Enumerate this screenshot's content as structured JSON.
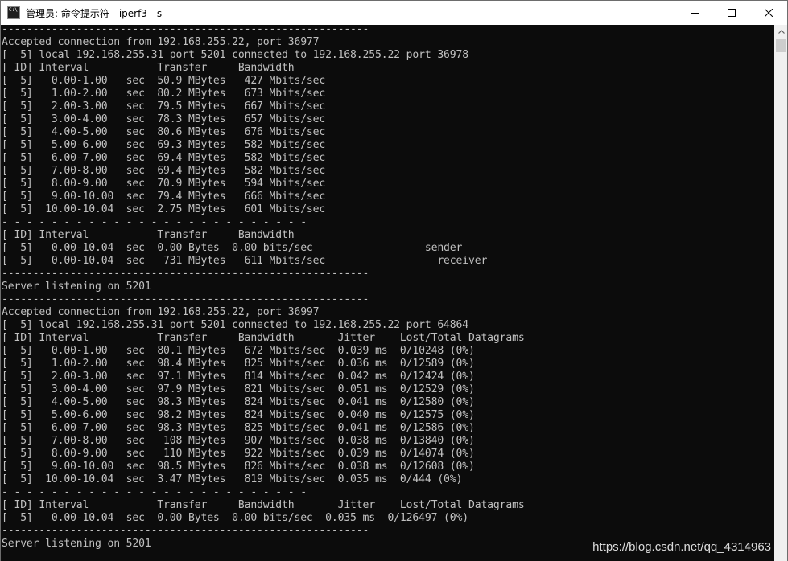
{
  "window": {
    "title": "管理员: 命令提示符 - iperf3  -s",
    "icon": "cmd-icon",
    "controls": {
      "minimize": "minimize-icon",
      "maximize": "maximize-icon",
      "close": "close-icon"
    }
  },
  "console": {
    "lines": [
      "-----------------------------------------------------------",
      "Accepted connection from 192.168.255.22, port 36977",
      "[  5] local 192.168.255.31 port 5201 connected to 192.168.255.22 port 36978",
      "[ ID] Interval           Transfer     Bandwidth",
      "[  5]   0.00-1.00   sec  50.9 MBytes   427 Mbits/sec",
      "[  5]   1.00-2.00   sec  80.2 MBytes   673 Mbits/sec",
      "[  5]   2.00-3.00   sec  79.5 MBytes   667 Mbits/sec",
      "[  5]   3.00-4.00   sec  78.3 MBytes   657 Mbits/sec",
      "[  5]   4.00-5.00   sec  80.6 MBytes   676 Mbits/sec",
      "[  5]   5.00-6.00   sec  69.3 MBytes   582 Mbits/sec",
      "[  5]   6.00-7.00   sec  69.4 MBytes   582 Mbits/sec",
      "[  5]   7.00-8.00   sec  69.4 MBytes   582 Mbits/sec",
      "[  5]   8.00-9.00   sec  70.9 MBytes   594 Mbits/sec",
      "[  5]   9.00-10.00  sec  79.4 MBytes   666 Mbits/sec",
      "[  5]  10.00-10.04  sec  2.75 MBytes   601 Mbits/sec",
      "- - - - - - - - - - - - - - - - - - - - - - - - -",
      "[ ID] Interval           Transfer     Bandwidth",
      "[  5]   0.00-10.04  sec  0.00 Bytes  0.00 bits/sec                  sender",
      "[  5]   0.00-10.04  sec   731 MBytes   611 Mbits/sec                  receiver",
      "-----------------------------------------------------------",
      "Server listening on 5201",
      "-----------------------------------------------------------",
      "Accepted connection from 192.168.255.22, port 36997",
      "[  5] local 192.168.255.31 port 5201 connected to 192.168.255.22 port 64864",
      "[ ID] Interval           Transfer     Bandwidth       Jitter    Lost/Total Datagrams",
      "[  5]   0.00-1.00   sec  80.1 MBytes   672 Mbits/sec  0.039 ms  0/10248 (0%)",
      "[  5]   1.00-2.00   sec  98.4 MBytes   825 Mbits/sec  0.036 ms  0/12589 (0%)",
      "[  5]   2.00-3.00   sec  97.1 MBytes   814 Mbits/sec  0.042 ms  0/12424 (0%)",
      "[  5]   3.00-4.00   sec  97.9 MBytes   821 Mbits/sec  0.051 ms  0/12529 (0%)",
      "[  5]   4.00-5.00   sec  98.3 MBytes   824 Mbits/sec  0.041 ms  0/12580 (0%)",
      "[  5]   5.00-6.00   sec  98.2 MBytes   824 Mbits/sec  0.040 ms  0/12575 (0%)",
      "[  5]   6.00-7.00   sec  98.3 MBytes   825 Mbits/sec  0.041 ms  0/12586 (0%)",
      "[  5]   7.00-8.00   sec   108 MBytes   907 Mbits/sec  0.038 ms  0/13840 (0%)",
      "[  5]   8.00-9.00   sec   110 MBytes   922 Mbits/sec  0.039 ms  0/14074 (0%)",
      "[  5]   9.00-10.00  sec  98.5 MBytes   826 Mbits/sec  0.038 ms  0/12608 (0%)",
      "[  5]  10.00-10.04  sec  3.47 MBytes   819 Mbits/sec  0.035 ms  0/444 (0%)",
      "- - - - - - - - - - - - - - - - - - - - - - - - -",
      "[ ID] Interval           Transfer     Bandwidth       Jitter    Lost/Total Datagrams",
      "[  5]   0.00-10.04  sec  0.00 Bytes  0.00 bits/sec  0.035 ms  0/126497 (0%)",
      "-----------------------------------------------------------",
      "Server listening on 5201"
    ]
  },
  "watermark": "https://blog.csdn.net/qq_4314963"
}
